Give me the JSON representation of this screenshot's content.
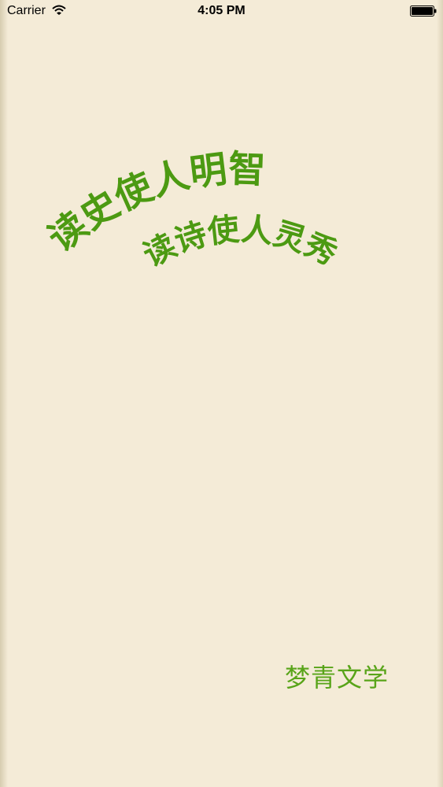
{
  "status_bar": {
    "carrier": "Carrier",
    "time": "4:05 PM",
    "wifi_icon": "wifi-icon",
    "battery_icon": "battery-icon"
  },
  "splash": {
    "line1": "读史使人明智",
    "line2": "读诗使人灵秀",
    "brand": "梦青文学",
    "text_color": "#4c9a12",
    "background_color": "#f4ebd7"
  }
}
